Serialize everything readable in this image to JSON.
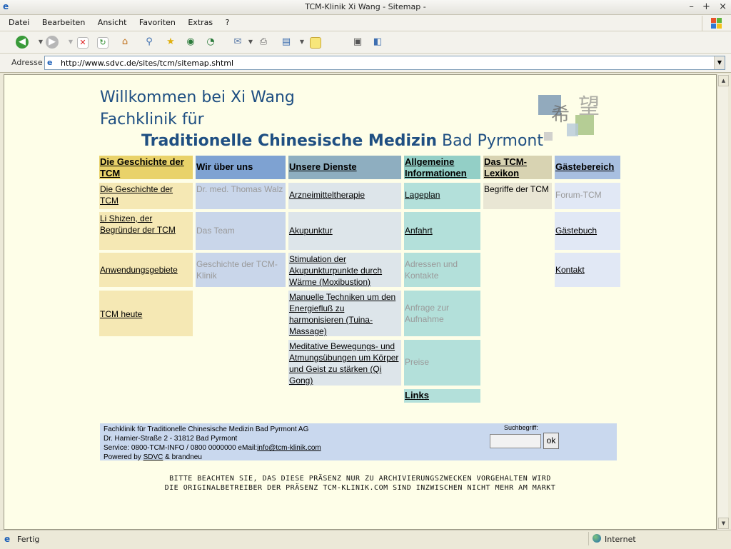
{
  "window": {
    "title": "TCM-Klinik Xi Wang - Sitemap -",
    "controls": [
      "–",
      "+",
      "×"
    ]
  },
  "menu": [
    "Datei",
    "Bearbeiten",
    "Ansicht",
    "Favoriten",
    "Extras",
    "?"
  ],
  "address": {
    "label": "Adresse",
    "url": "http://www.sdvc.de/sites/tcm/sitemap.shtml"
  },
  "status": {
    "text": "Fertig",
    "zone": "Internet"
  },
  "page": {
    "heading1": "Willkommen bei Xi Wang",
    "heading2": "Fachklinik für",
    "heading3_bold": "Traditionelle Chinesische Medizin",
    "heading3_rest": " Bad Pyrmont",
    "columns": {
      "geschichte": {
        "header": "Die Geschichte der TCM",
        "items": [
          "Die Geschichte der TCM",
          "Li Shizen, der Begründer der TCM",
          "Anwendungsgebiete",
          "TCM heute"
        ]
      },
      "wir": {
        "header": "Wir über uns",
        "items": [
          "Dr. med. Thomas Walz",
          "Das Team",
          "Geschichte der TCM-Klinik"
        ]
      },
      "dienste": {
        "header": "Unsere Dienste",
        "items": [
          "Arzneimitteltherapie",
          "Akupunktur",
          "Stimulation der Akupunkturpunkte durch Wärme (Moxibustion)",
          "Manuelle Techniken um den Energiefluß zu harmonisieren (Tuina-Massage)",
          "Meditative Bewegungs- und Atmungsübungen um Körper und Geist zu stärken (Qi Gong)"
        ]
      },
      "info": {
        "header": "Allgemeine Informationen",
        "items": [
          "Lageplan",
          "Anfahrt",
          "Adressen und Kontakte",
          "Anfrage zur Aufnahme",
          "Preise",
          "Links"
        ]
      },
      "lexikon": {
        "header": "Das TCM-Lexikon",
        "items": [
          "Begriffe der TCM"
        ]
      },
      "gaeste": {
        "header": "Gästebereich",
        "items": [
          "Forum-TCM",
          "Gästebuch",
          "Kontakt"
        ]
      }
    },
    "footer": {
      "line1": "Fachklinik für Traditionelle Chinesische Medizin Bad Pyrmont AG",
      "line2": "Dr. Harnier-Straße 2  -  31812 Bad Pyrmont",
      "line3_prefix": "Service: 0800-TCM-INFO / 0800 0000000 eMail:",
      "email": "info@tcm-klinik.com",
      "line4_prefix": "Powered by ",
      "powered_link": "SDVC",
      "line4_suffix": " & brandneu",
      "search_label": "Suchbegriff:",
      "search_value": "",
      "ok_label": "ok"
    },
    "notice_line1": "BITTE BEACHTEN SIE, DAS DIESE PRÄSENZ NUR ZU ARCHIVIERUNGSZWECKEN VORGEHALTEN WIRD",
    "notice_line2": "DIE ORIGINALBETREIBER DER PRÄSENZ TCM-KLINIK.COM SIND INZWISCHEN NICHT MEHR AM MARKT"
  },
  "colors": {
    "heading": "#1f4f82",
    "geschichte_header": "#e9d26a",
    "geschichte_cell": "#f5e8b4",
    "wir_header": "#7ea2d2",
    "wir_cell": "#c9d6ea",
    "dienste_header": "#8eaec0",
    "dienste_cell": "#dde5ea",
    "info_header": "#93cfc6",
    "info_cell": "#b3e0da",
    "lexikon_header": "#d8d3b2",
    "lexikon_cell": "#e9e6d4",
    "gaeste_header": "#a8bfe0",
    "gaeste_cell": "#e1e8f5",
    "footer_bg": "#c9d8ee"
  }
}
